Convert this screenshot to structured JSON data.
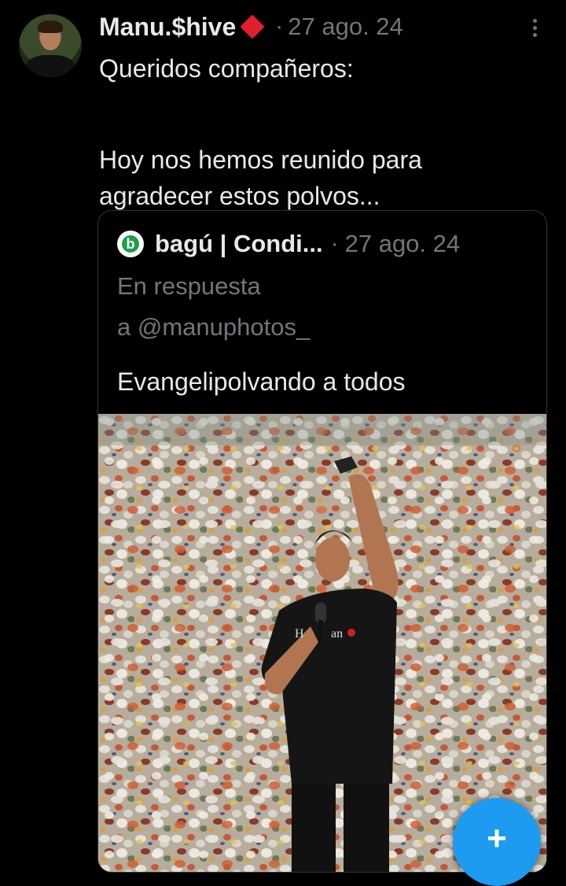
{
  "tweet": {
    "author_name": "Manu.$hive",
    "separator": "·",
    "date": "27 ago. 24",
    "text_line1": "Queridos compañeros:",
    "text_line2": "Hoy nos hemos reunido para agradecer estos polvos...",
    "badge_icon": "red-diamond-icon",
    "more_icon": "more-vertical-icon"
  },
  "quoted": {
    "author_name": "bagú | Condi...",
    "separator": "·",
    "date": "27 ago. 24",
    "reply_line1": "En respuesta",
    "reply_line2": "a @manuphotos_",
    "text": "Evangelipolvando a todos",
    "logo_icon": "bagu-logo-icon"
  },
  "fab": {
    "label": "+",
    "icon": "plus-icon",
    "color": "#1d9bf0"
  },
  "colors": {
    "background": "#000000",
    "text": "#e7e9ea",
    "muted": "#71767b",
    "accent": "#1d9bf0",
    "badge": "#e0202e"
  }
}
